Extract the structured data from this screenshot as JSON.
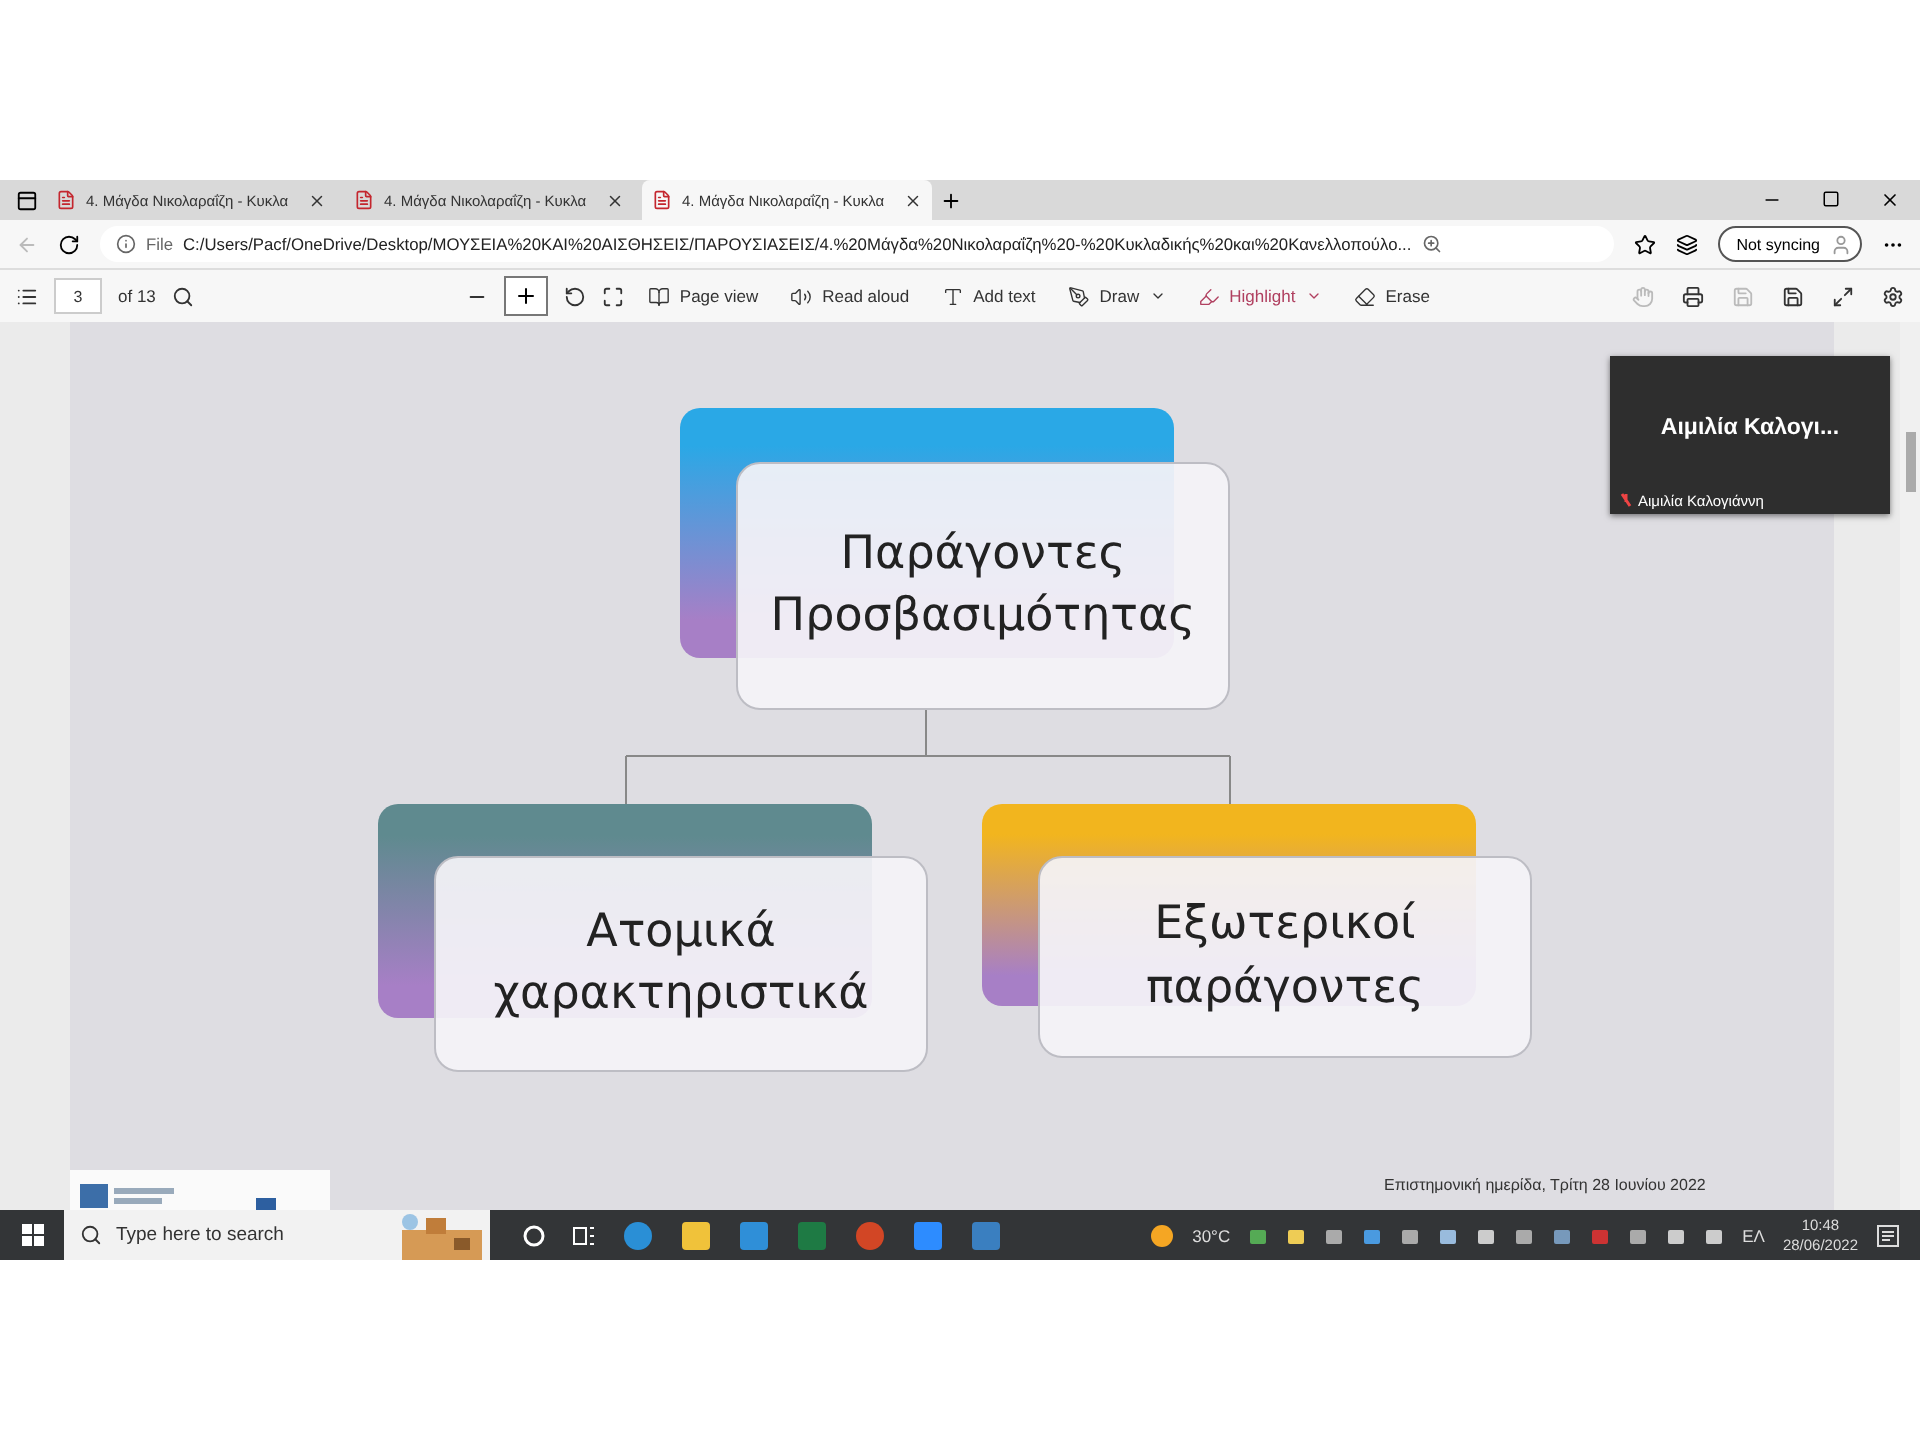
{
  "tabs": [
    {
      "title": "4. Μάγδα Νικολαραΐζη - Κυκλα",
      "selected": false
    },
    {
      "title": "4. Μάγδα Νικολαραΐζη - Κυκλα",
      "selected": false
    },
    {
      "title": "4. Μάγδα Νικολαραΐζη - Κυκλα",
      "selected": true
    }
  ],
  "address": {
    "prefix": "File",
    "url": "C:/Users/Pacf/OneDrive/Desktop/ΜΟΥΣΕΙΑ%20ΚΑΙ%20ΑΙΣΘΗΣΕΙΣ/ΠΑΡΟΥΣΙΑΣΕΙΣ/4.%20Μάγδα%20Νικολαραΐζη%20-%20Κυκλαδικής%20και%20Κανελλοπούλο..."
  },
  "profile": {
    "label": "Not syncing"
  },
  "pdf_toolbar": {
    "page": "3",
    "page_count": "of 13",
    "tools": [
      {
        "kind": "page",
        "label": "Page view"
      },
      {
        "kind": "read",
        "label": "Read aloud"
      },
      {
        "kind": "text",
        "label": "Add text"
      },
      {
        "kind": "draw",
        "label": "Draw"
      },
      {
        "kind": "highlight",
        "label": "Highlight"
      },
      {
        "kind": "erase",
        "label": "Erase"
      }
    ]
  },
  "diagram": {
    "root": {
      "text": "Παράγοντες Προσβασιμότητας",
      "color": "#2aa8e6"
    },
    "children": [
      {
        "text": "Ατομικά χαρακτηριστικά",
        "color": "#5f8a8f"
      },
      {
        "text": "Εξωτερικοί παράγοντες",
        "color": "#f2b51e"
      }
    ]
  },
  "video": {
    "title": "Αιμιλία Καλογι...",
    "name": "Αιμιλία Καλογιάννη"
  },
  "footer": "Επιστημονική ημερίδα, Τρίτη 28 Ιουνίου 2022",
  "taskbar": {
    "search_placeholder": "Type here to search",
    "weather": "30°C",
    "language": "ΕΛ",
    "time": "10:48",
    "date": "28/06/2022"
  }
}
